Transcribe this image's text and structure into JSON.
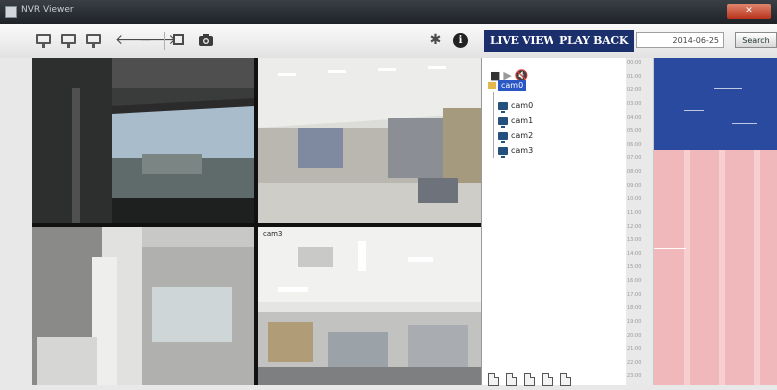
{
  "window": {
    "title": "NVR Viewer",
    "close_label": "✕"
  },
  "toolbar": {
    "icons": [
      "monitor-icon",
      "monitor-icon",
      "monitor-icon",
      "back-arrow-icon",
      "forward-arrow-icon",
      "folder-icon",
      "camera-icon",
      "settings-icon",
      "info-icon"
    ],
    "live_view_label": "LIVE VIEW",
    "play_back_label": "PLAY BACK",
    "date_value": "2014-06-25",
    "search_label": "Search"
  },
  "grid": {
    "cells": [
      {
        "label": ""
      },
      {
        "label": ""
      },
      {
        "label": ""
      },
      {
        "label": "cam3"
      }
    ]
  },
  "tree": {
    "controls": [
      "stop-icon",
      "play-icon",
      "mute-icon"
    ],
    "root_label": "cam0",
    "items": [
      "cam0",
      "cam1",
      "cam2",
      "cam3"
    ],
    "footer_icons": [
      "doc-icon",
      "doc-icon",
      "doc-icon",
      "doc-icon",
      "doc-icon"
    ]
  },
  "timeline": {
    "time_labels": [
      "00:00",
      "01:00",
      "02:00",
      "03:00",
      "04:00",
      "05:00",
      "06:00",
      "07:00",
      "08:00",
      "09:00",
      "10:00",
      "11:00",
      "12:00",
      "13:00",
      "14:00",
      "15:00",
      "16:00",
      "17:00",
      "18:00",
      "19:00",
      "20:00",
      "21:00",
      "22:00",
      "23:00"
    ],
    "colors": {
      "recorded": "#2a4aa0",
      "empty": "#f1b8bb"
    }
  }
}
